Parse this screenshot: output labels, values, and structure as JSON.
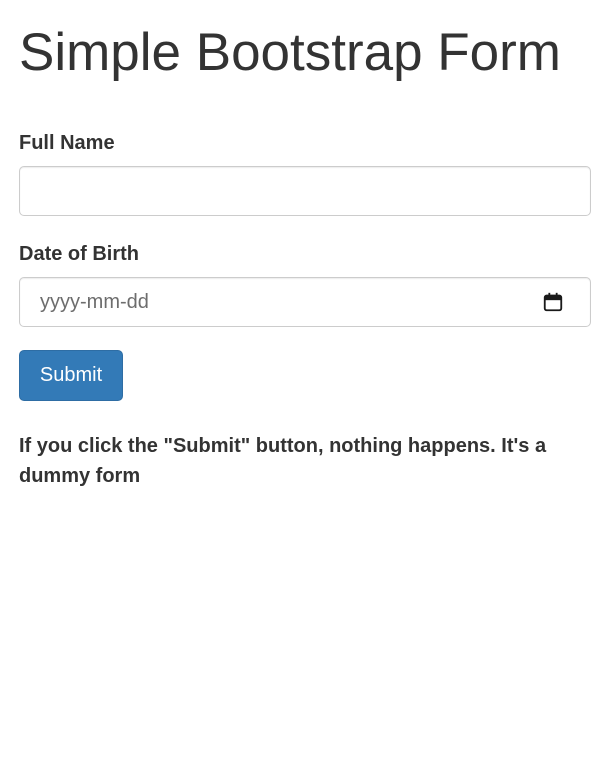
{
  "page": {
    "title": "Simple Bootstrap Form"
  },
  "form": {
    "full_name": {
      "label": "Full Name",
      "value": "",
      "placeholder": ""
    },
    "date_of_birth": {
      "label": "Date of Birth",
      "placeholder": "yyyy-mm-dd",
      "icon": "calendar-icon"
    },
    "submit_label": "Submit",
    "note": "If you click the \"Submit\" button, nothing happens. It's a dummy form"
  },
  "colors": {
    "text": "#333333",
    "primary_button": "#337ab7",
    "input_border": "#cccccc"
  }
}
